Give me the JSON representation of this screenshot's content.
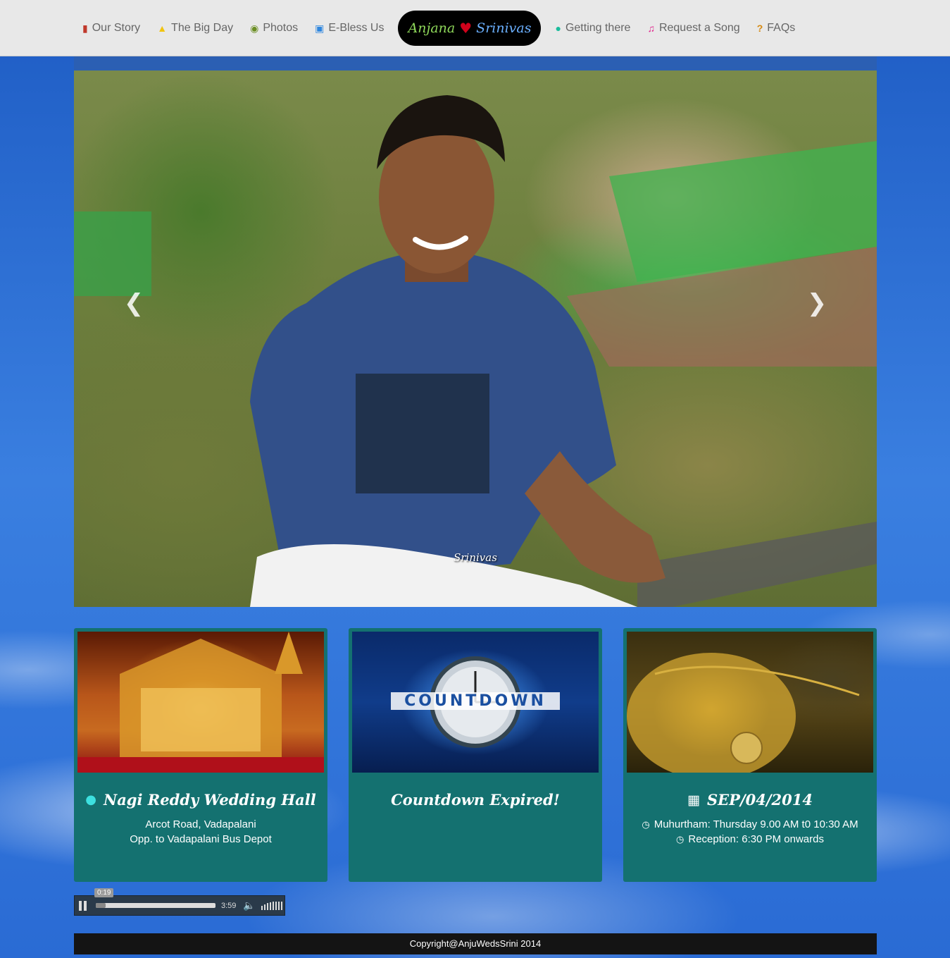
{
  "nav": {
    "items_left": [
      {
        "label": "Our Story",
        "icon": "book-icon",
        "icon_color": "#c0392b",
        "glyph": "▮"
      },
      {
        "label": "The Big Day",
        "icon": "bell-icon",
        "icon_color": "#f1c40f",
        "glyph": "🔔"
      },
      {
        "label": "Photos",
        "icon": "camera-icon",
        "icon_color": "#6b8e23",
        "glyph": "◙"
      },
      {
        "label": "E-Bless Us",
        "icon": "gift-icon",
        "icon_color": "#2e86de",
        "glyph": "🎁"
      }
    ],
    "brand": {
      "name1": "Anjana",
      "name2": "Srinivas",
      "icon": "heart-icon"
    },
    "items_right": [
      {
        "label": "Getting there",
        "icon": "map-marker-icon",
        "icon_color": "#1abc9c",
        "glyph": "⚲"
      },
      {
        "label": "Request a Song",
        "icon": "music-icon",
        "icon_color": "#e0218a",
        "glyph": "♫"
      },
      {
        "label": "FAQs",
        "icon": "question-icon",
        "icon_color": "#d68910",
        "glyph": "?"
      }
    ]
  },
  "hero": {
    "caption": "Srinivas",
    "prev_icon": "chevron-left-icon",
    "next_icon": "chevron-right-icon"
  },
  "cards": {
    "venue": {
      "title": "Nagi Reddy Wedding Hall",
      "icon": "map-marker-icon",
      "line1": "Arcot Road, Vadapalani",
      "line2": "Opp. to Vadapalani Bus Depot"
    },
    "countdown": {
      "title": "Countdown Expired!",
      "image_text": "COUNTDOWN"
    },
    "date": {
      "title": "SEP/04/2014",
      "icon": "calendar-icon",
      "line1": "Muhurtham: Thursday 9.00 AM t0 10:30 AM",
      "line2": "Reception: 6:30 PM onwards"
    }
  },
  "player": {
    "current_time": "0:19",
    "duration": "3:59",
    "progress": 0.08
  },
  "footer": {
    "copyright": "Copyright@AnjuWedsSrini 2014"
  }
}
